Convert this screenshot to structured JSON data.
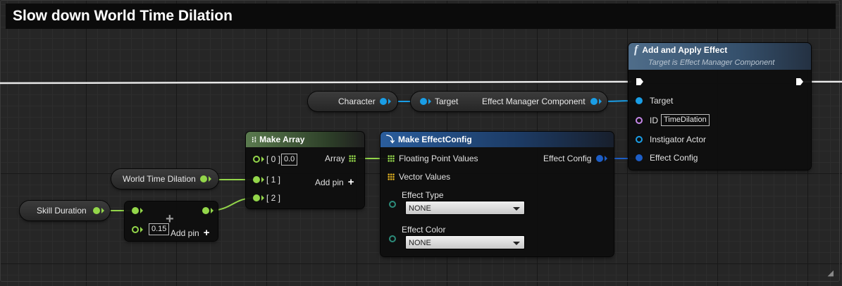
{
  "comment": {
    "title": "Slow down World Time Dilation"
  },
  "pills": {
    "character": "Character",
    "world_time_dilation": "World Time Dilation",
    "skill_duration": "Skill Duration"
  },
  "cast_node": {
    "target_label": "Target",
    "output_label": "Effect Manager Component"
  },
  "add_apply_node": {
    "title": "Add and Apply Effect",
    "subtitle": "Target is Effect Manager Component",
    "target_label": "Target",
    "id_label": "ID",
    "id_value": "TimeDilation",
    "instigator_label": "Instigator Actor",
    "effect_config_label": "Effect Config"
  },
  "make_array_node": {
    "title": "Make Array",
    "pin0_label": "[ 0 ]",
    "pin0_value": "0.0",
    "pin1_label": "[ 1 ]",
    "pin2_label": "[ 2 ]",
    "output_label": "Array",
    "add_pin_label": "Add pin"
  },
  "multiply_node": {
    "value": "0.15",
    "add_pin_label": "Add pin"
  },
  "make_effect_config_node": {
    "title": "Make EffectConfig",
    "floating_point_label": "Floating Point Values",
    "vector_values_label": "Vector Values",
    "effect_type_label": "Effect Type",
    "effect_type_value": "NONE",
    "effect_color_label": "Effect Color",
    "effect_color_value": "NONE",
    "output_label": "Effect Config"
  },
  "colors": {
    "float_pin": "#93d64a",
    "object_pin": "#1a9ee6",
    "struct_pin": "#1d5ec7",
    "name_pin": "#c587e8",
    "enum_pin": "#2c8c7a"
  }
}
